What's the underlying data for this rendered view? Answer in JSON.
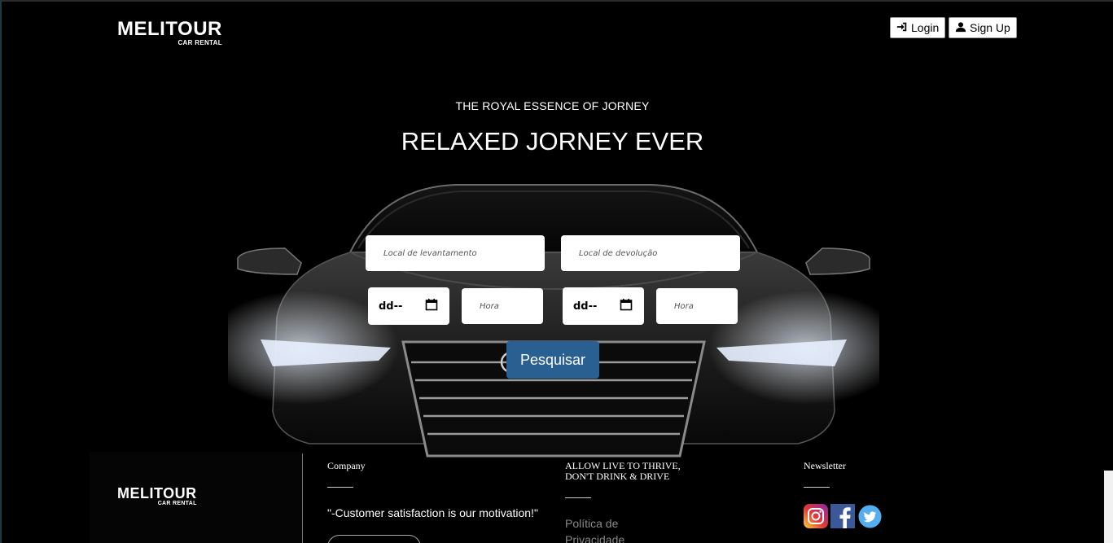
{
  "header": {
    "brand": "MELITOUR",
    "brand_sub": "CAR RENTAL",
    "login_label": "Login",
    "signup_label": "Sign Up"
  },
  "hero": {
    "tagline": "THE ROYAL ESSENCE OF JORNEY",
    "headline": "RELAXED JORNEY EVER"
  },
  "search": {
    "pickup_placeholder": "Local de levantamento",
    "return_placeholder": "Local de devolução",
    "pickup_date_value": "dd--",
    "pickup_hour_placeholder": "Hora",
    "return_date_value": "dd--",
    "return_hour_placeholder": "Hora",
    "submit_label": "Pesquisar"
  },
  "footer": {
    "brand": "MELITOUR",
    "brand_sub": "CAR RENTAL",
    "company_heading": "Company",
    "motto": "\"-Customer satisfaction is our motivation!\"",
    "thrive_heading": "ALLOW LIVE TO THRIVE, DON'T DRINK & DRIVE",
    "policy_link": "Política de Privacidade",
    "newsletter_heading": "Newsletter",
    "social": [
      "instagram-icon",
      "facebook-icon",
      "twitter-icon"
    ]
  },
  "colors": {
    "background": "#000000",
    "accent_button": "#2a5f91",
    "field_background": "#ffffff"
  }
}
